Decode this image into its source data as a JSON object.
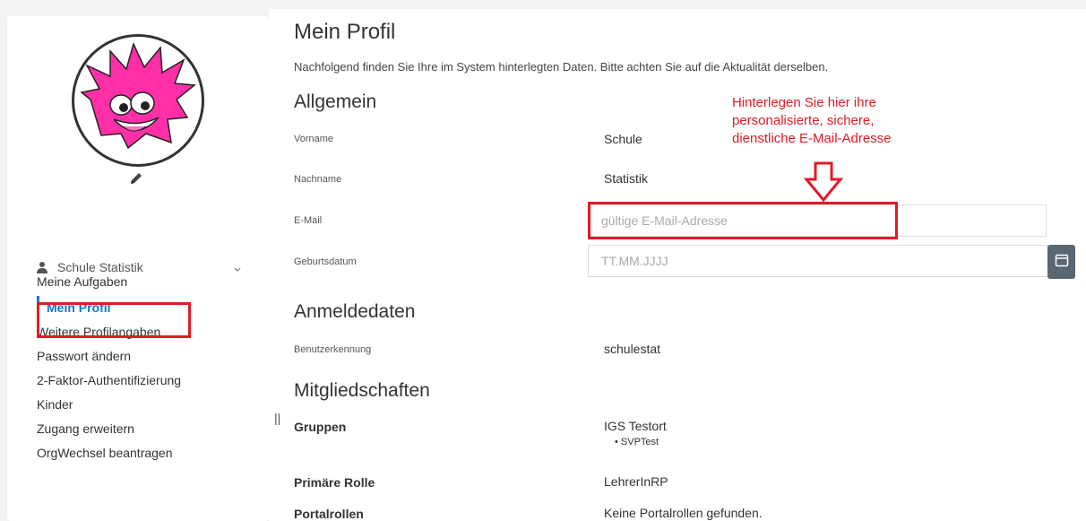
{
  "sidebar": {
    "user_name": "Schule Statistik",
    "items": [
      {
        "label": "Meine Aufgaben"
      },
      {
        "label": "Mein Profil"
      },
      {
        "label": "Weitere Profilangaben"
      },
      {
        "label": "Passwort ändern"
      },
      {
        "label": "2-Faktor-Authentifizierung"
      },
      {
        "label": "Kinder"
      },
      {
        "label": "Zugang erweitern"
      },
      {
        "label": "OrgWechsel beantragen"
      }
    ]
  },
  "main": {
    "title": "Mein Profil",
    "intro": "Nachfolgend finden Sie Ihre im System hinterlegten Daten. Bitte achten Sie auf die Aktualität derselben.",
    "general": {
      "heading": "Allgemein",
      "vorname_label": "Vorname",
      "vorname_value": "Schule",
      "nachname_label": "Nachname",
      "nachname_value": "Statistik",
      "email_label": "E-Mail",
      "email_placeholder": "gültige E-Mail-Adresse",
      "geburtsdatum_label": "Geburtsdatum",
      "geburtsdatum_placeholder": "TT.MM.JJJJ"
    },
    "login": {
      "heading": "Anmeldedaten",
      "benutzerkennung_label": "Benutzerkennung",
      "benutzerkennung_value": "schulestat"
    },
    "memberships": {
      "heading": "Mitgliedschaften",
      "gruppen_label": "Gruppen",
      "gruppen_value": "IGS Testort",
      "gruppen_sub": "SVPTest",
      "rolle_label": "Primäre Rolle",
      "rolle_value": "LehrerInRP",
      "portalrollen_label": "Portalrollen",
      "portalrollen_value": "Keine Portalrollen gefunden."
    }
  },
  "annotation": {
    "line1": "Hinterlegen Sie hier ihre",
    "line2": "personalisierte, sichere,",
    "line3": "dienstliche E-Mail-Adresse"
  },
  "colors": {
    "accent": "#1a73c8",
    "highlight": "#e01b24",
    "avatar_pink": "#ff2fa8"
  },
  "icons": {
    "edit": "pencil-icon",
    "user": "person-icon",
    "expand": "chevron-down-icon",
    "calendar": "calendar-icon",
    "annotation_arrow": "arrow-down-icon"
  }
}
